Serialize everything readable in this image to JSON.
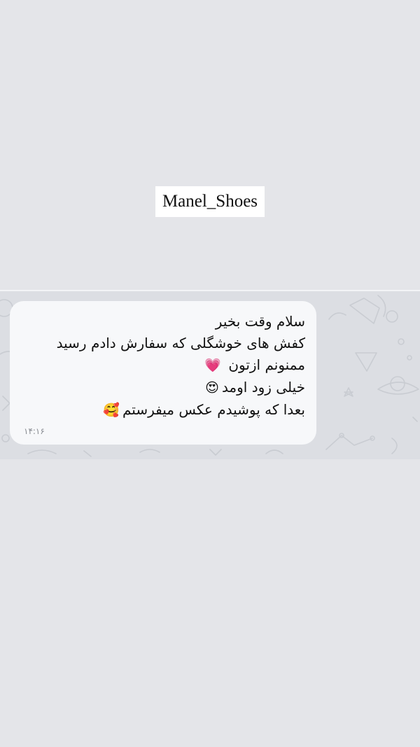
{
  "header": {
    "brand_label": "Manel_Shoes"
  },
  "message": {
    "lines": [
      {
        "text": "سلام وقت بخیر",
        "emoji": ""
      },
      {
        "text": "کفش های خوشگلی که سفارش دادم رسید",
        "emoji": ""
      },
      {
        "text": "ممنونم ازتون",
        "emoji": "💗"
      },
      {
        "text": "خیلی زود اومد",
        "emoji": "😍"
      },
      {
        "text": "بعدا که پوشیدم عکس میفرستم",
        "emoji": "🥰"
      }
    ],
    "time": "۱۴:۱۶",
    "bubble_color": "#f7f8fa"
  },
  "colors": {
    "page_background": "#e4e5e9",
    "chat_background": "#dcdee3"
  }
}
